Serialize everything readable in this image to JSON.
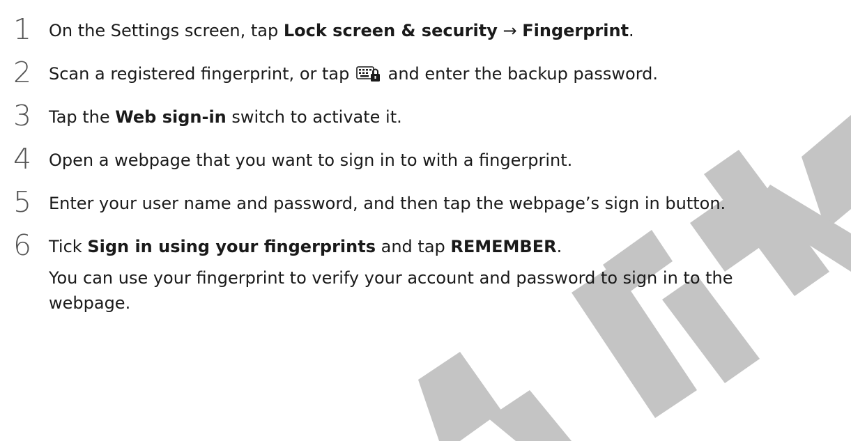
{
  "watermark": {
    "color": "#c4c4c4"
  },
  "steps": [
    {
      "num": "1",
      "t1": "On the Settings screen, tap ",
      "b1": "Lock screen & security",
      "t2": " → ",
      "b2": "Fingerprint",
      "t3": "."
    },
    {
      "num": "2",
      "t1": "Scan a registered fingerprint, or tap ",
      "icon": "keyboard-lock-icon",
      "t2": " and enter the backup password."
    },
    {
      "num": "3",
      "t1": "Tap the ",
      "b1": "Web sign-in",
      "t2": " switch to activate it."
    },
    {
      "num": "4",
      "t1": "Open a webpage that you want to sign in to with a fingerprint."
    },
    {
      "num": "5",
      "t1": "Enter your user name and password, and then tap the webpage’s sign in button."
    },
    {
      "num": "6",
      "t1": "Tick ",
      "b1": "Sign in using your fingerprints",
      "t2": " and tap ",
      "b2": "REMEMBER",
      "t3": ".",
      "note_line1": "You can use your fingerprint to verify your account and password to sign in to the",
      "note_line2": "webpage."
    }
  ]
}
